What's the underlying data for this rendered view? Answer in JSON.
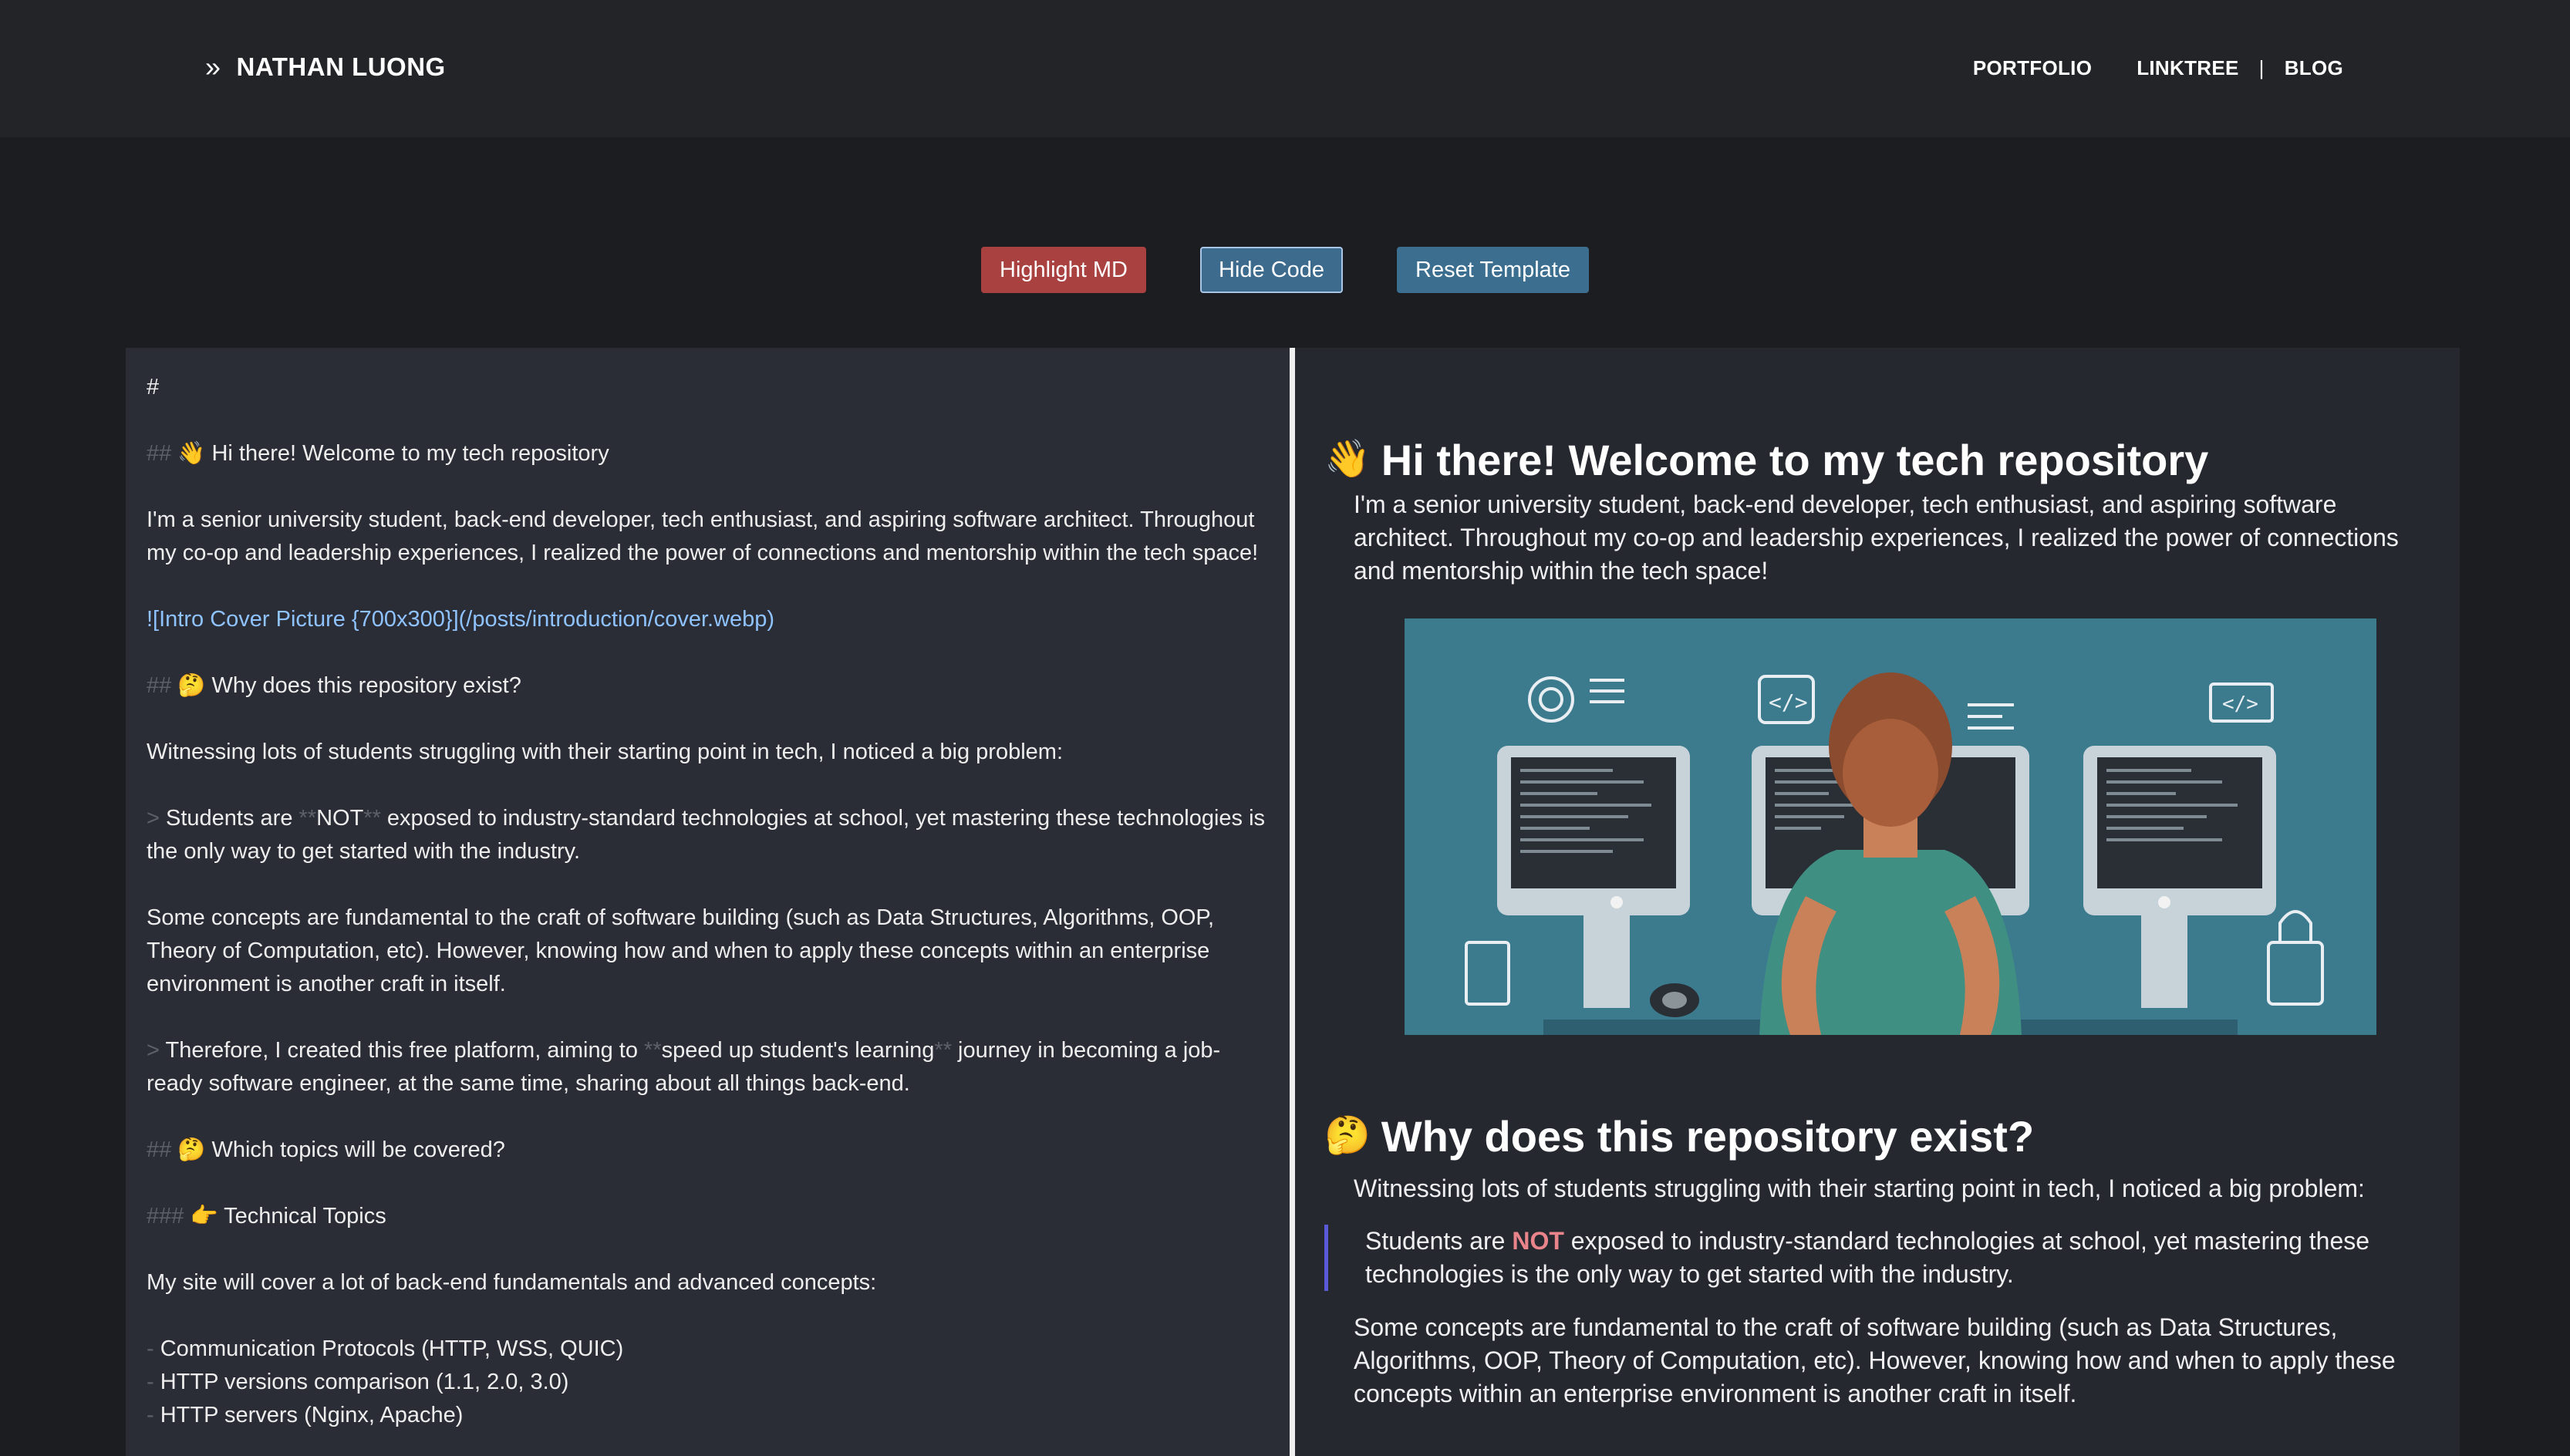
{
  "header": {
    "brand_icon": "chevron-double-right-icon",
    "brand_name": "NATHAN LUONG",
    "nav": {
      "portfolio": "PORTFOLIO",
      "linktree": "LINKTREE",
      "separator": "|",
      "blog": "BLOG"
    }
  },
  "toolbar": {
    "highlight_label": "Highlight MD",
    "hide_code_label": "Hide Code",
    "reset_label": "Reset Template"
  },
  "editor": {
    "line_hash": "#",
    "h2_mark": "##",
    "h3_mark": "###",
    "quote_mark": ">",
    "bold_mark": "**",
    "list_mark": "-",
    "h2_welcome": "👋 Hi there! Welcome to my tech repository",
    "intro": "I'm a senior university student, back-end developer, tech enthusiast, and aspiring software architect. Throughout my co-op and leadership experiences, I realized the power of connections and mentorship within the tech space!",
    "image_md": "![Intro Cover Picture {700x300}](/posts/introduction/cover.webp)",
    "h2_why": "🤔 Why does this repository exist?",
    "witness": "Witnessing lots of students struggling with their starting point in tech, I noticed a big problem:",
    "q1_a": "Students are ",
    "q1_bold": "NOT",
    "q1_b": " exposed to industry-standard technologies at school, yet mastering these technologies is the only way to get started with the industry.",
    "concepts": "Some concepts are fundamental to the craft of software building (such as Data Structures, Algorithms, OOP, Theory of Computation, etc). However, knowing how and when to apply these concepts within an enterprise environment is another craft in itself.",
    "q2_a": "Therefore, I created this free platform, aiming to ",
    "q2_bold": "speed up student's learning",
    "q2_b": " journey in becoming a job-ready software engineer, at the same time, sharing about all things back-end.",
    "h2_topics": "🤔 Which topics will be covered?",
    "h3_tech": "👉 Technical Topics",
    "cover_text": "My site will cover a lot of back-end fundamentals and advanced concepts:",
    "list": [
      "Communication Protocols (HTTP, WSS, QUIC)",
      "HTTP versions comparison (1.1, 2.0, 3.0)",
      "HTTP servers (Nginx, Apache)"
    ]
  },
  "preview": {
    "h2_welcome_emoji": "👋",
    "h2_welcome": "Hi there! Welcome to my tech repository",
    "intro": "I'm a senior university student, back-end developer, tech enthusiast, and aspiring software architect. Throughout my co-op and leadership experiences, I realized the power of connections and mentorship within the tech space!",
    "h2_why_emoji": "🤔",
    "h2_why": "Why does this repository exist?",
    "witness": "Witnessing lots of students struggling with their starting point in tech, I noticed a big problem:",
    "q1_a": "Students are ",
    "q1_bold": "NOT",
    "q1_b": " exposed to industry-standard technologies at school, yet mastering these technologies is the only way to get started with the industry.",
    "concepts": "Some concepts are fundamental to the craft of software building (such as Data Structures, Algorithms, OOP, Theory of Computation, etc). However, knowing how and when to apply these concepts within an enterprise environment is another craft in itself."
  },
  "colors": {
    "page_bg": "#1c1d21",
    "header_bg": "#232428",
    "editor_bg": "#2b2d36",
    "preview_bg": "#262830",
    "highlight_btn": "#a8413f",
    "hide_btn": "#3d6b8e",
    "reset_btn": "#3b6e8f",
    "link": "#8fc3ff",
    "quote_bar": "#5a5ad8",
    "strong_text": "#e9848a",
    "cover_bg": "#3c7b8e"
  }
}
